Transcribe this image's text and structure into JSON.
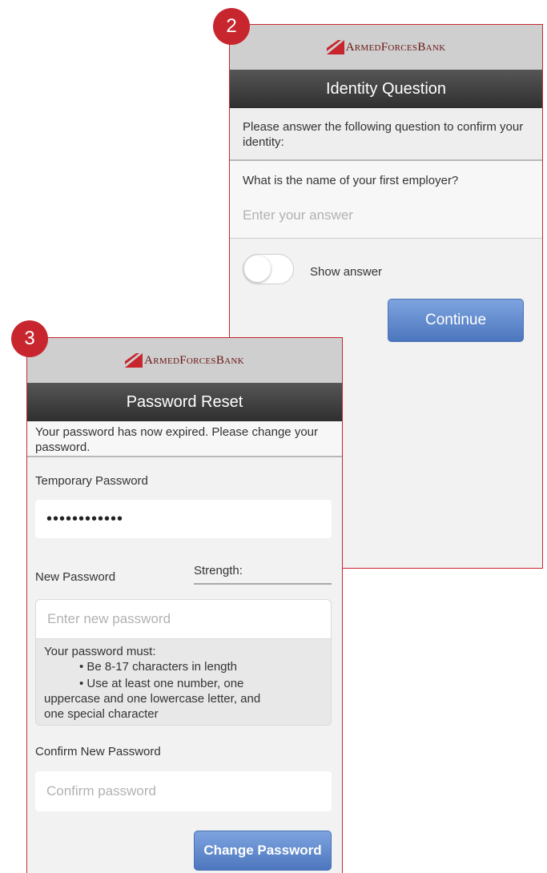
{
  "brand": {
    "logo_text": "ArmedForcesBank",
    "logo_color": "#c8262f"
  },
  "screen2": {
    "step_number": "2",
    "title": "Identity Question",
    "instruction": "Please answer the following question to confirm your identity:",
    "question": "What is the name of your first employer?",
    "answer_placeholder": "Enter your answer",
    "toggle_label": "Show answer",
    "toggle_on": false,
    "continue_label": "Continue"
  },
  "screen3": {
    "step_number": "3",
    "title": "Password Reset",
    "notice": "Your password has now expired. Please change your password.",
    "temp_password_label": "Temporary Password",
    "temp_password_value": "••••••••••••",
    "new_password_label": "New Password",
    "strength_label": "Strength:",
    "new_password_placeholder": "Enter new password",
    "rules_heading": "Your password must:",
    "rules": [
      "• Be 8-17 characters in length",
      "• Use at least one number, one",
      "uppercase and one lowercase letter, and",
      "one special character"
    ],
    "confirm_label": "Confirm New Password",
    "confirm_placeholder": "Confirm password",
    "change_button_label": "Change Password"
  },
  "colors": {
    "accent_red": "#c8262f",
    "button_blue": "#5a82c8",
    "title_bar": "#3a3a3a"
  }
}
